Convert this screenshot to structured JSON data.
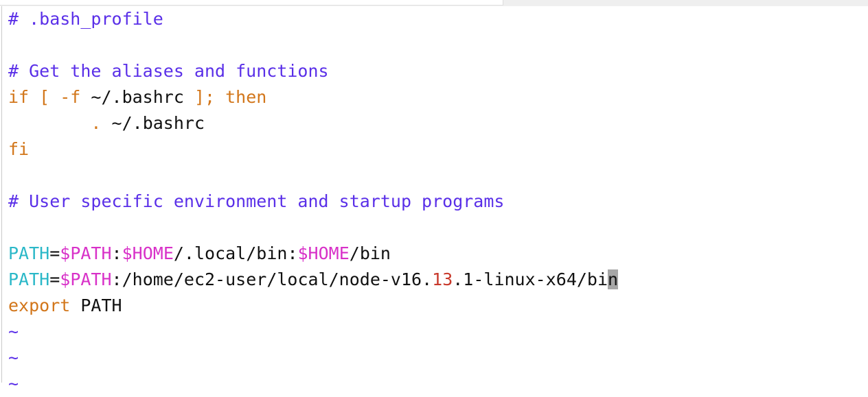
{
  "window": {
    "title": ".bash_profile",
    "app": "vim",
    "background_color": "#ffffff",
    "chrome_strip_color": "#efefef"
  },
  "colors": {
    "comment": "#5a2fe8",
    "keyword": "#d2761a",
    "variable_name": "#2bb8c8",
    "variable_expansion": "#d831c8",
    "plain_text": "#111111",
    "number_match": "#c8392b",
    "tilde_filler": "#5a2fe8",
    "cursor_block": "#a6a6a6",
    "gutter_line": "#c9c9c9"
  },
  "cursor": {
    "line": 12,
    "column": 58,
    "character": "n",
    "style": "block"
  },
  "lines": [
    {
      "n": 1,
      "tokens": [
        {
          "text": "# .bash_profile",
          "kind": "comment"
        }
      ]
    },
    {
      "n": 2,
      "tokens": []
    },
    {
      "n": 3,
      "tokens": [
        {
          "text": "# Get the aliases and functions",
          "kind": "comment"
        }
      ]
    },
    {
      "n": 4,
      "tokens": [
        {
          "text": "if [ -f ",
          "kind": "keyword"
        },
        {
          "text": "~/.bashrc",
          "kind": "plain"
        },
        {
          "text": " ]; then",
          "kind": "keyword"
        }
      ]
    },
    {
      "n": 5,
      "tokens": [
        {
          "text": "        ",
          "kind": "plain"
        },
        {
          "text": ".",
          "kind": "keyword"
        },
        {
          "text": " ~/.bashrc",
          "kind": "plain"
        }
      ]
    },
    {
      "n": 6,
      "tokens": [
        {
          "text": "fi",
          "kind": "keyword"
        }
      ]
    },
    {
      "n": 7,
      "tokens": []
    },
    {
      "n": 8,
      "tokens": [
        {
          "text": "# User specific environment and startup programs",
          "kind": "comment"
        }
      ]
    },
    {
      "n": 9,
      "tokens": []
    },
    {
      "n": 10,
      "tokens": [
        {
          "text": "PATH",
          "kind": "variable_name"
        },
        {
          "text": "=",
          "kind": "plain"
        },
        {
          "text": "$PATH",
          "kind": "variable_expansion"
        },
        {
          "text": ":",
          "kind": "plain"
        },
        {
          "text": "$HOME",
          "kind": "variable_expansion"
        },
        {
          "text": "/.local/bin:",
          "kind": "plain"
        },
        {
          "text": "$HOME",
          "kind": "variable_expansion"
        },
        {
          "text": "/bin",
          "kind": "plain"
        }
      ]
    },
    {
      "n": 11,
      "tokens": [
        {
          "text": "PATH",
          "kind": "variable_name"
        },
        {
          "text": "=",
          "kind": "plain"
        },
        {
          "text": "$PATH",
          "kind": "variable_expansion"
        },
        {
          "text": ":/home/ec2-user/local/node-v16.",
          "kind": "plain"
        },
        {
          "text": "13",
          "kind": "number"
        },
        {
          "text": ".1-linux-x64/bi",
          "kind": "plain"
        },
        {
          "text": "n",
          "kind": "cursor"
        }
      ]
    },
    {
      "n": 12,
      "tokens": [
        {
          "text": "export",
          "kind": "keyword"
        },
        {
          "text": " PATH",
          "kind": "plain"
        }
      ]
    },
    {
      "n": 13,
      "tokens": [
        {
          "text": "~",
          "kind": "tilde"
        }
      ]
    },
    {
      "n": 14,
      "tokens": [
        {
          "text": "~",
          "kind": "tilde"
        }
      ]
    },
    {
      "n": 15,
      "tokens": [
        {
          "text": "~",
          "kind": "tilde"
        }
      ]
    }
  ]
}
